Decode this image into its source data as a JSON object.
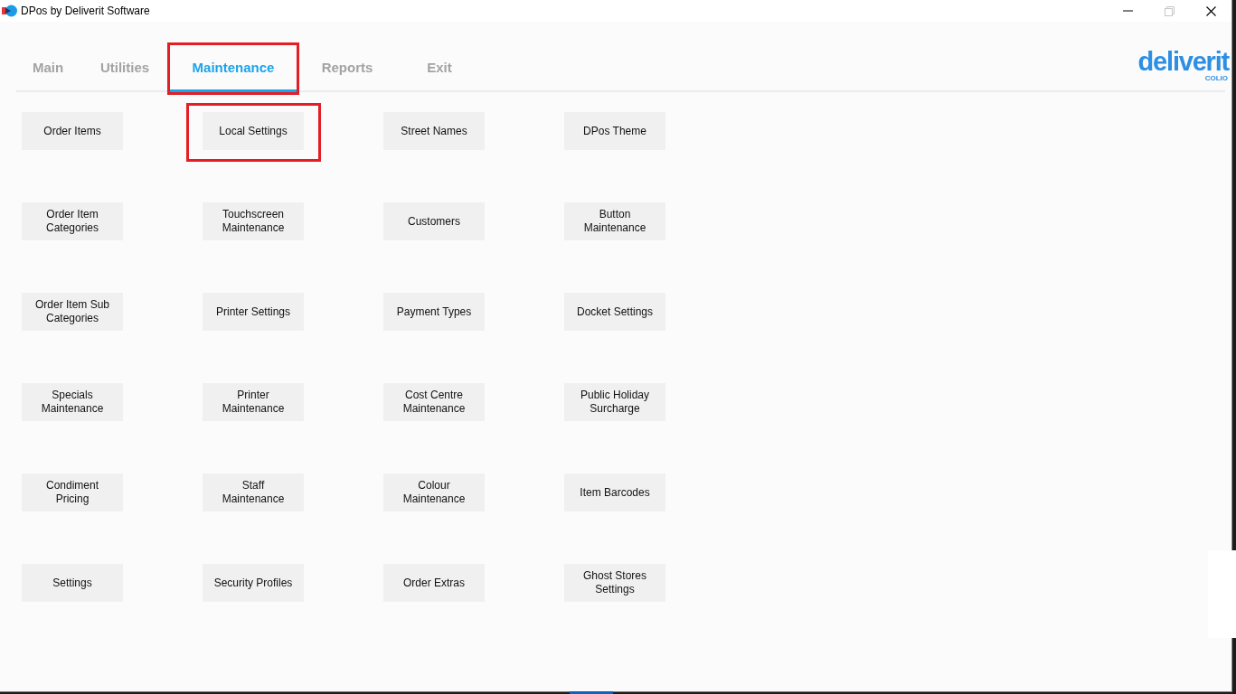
{
  "window": {
    "title": "DPos by Deliverit Software",
    "controls": [
      {
        "kind": "minimize",
        "disabled": false
      },
      {
        "kind": "restore",
        "disabled": true
      },
      {
        "kind": "close",
        "disabled": false
      }
    ]
  },
  "tabs": [
    {
      "label": "Main",
      "selected": false,
      "highlighted": false
    },
    {
      "label": "Utilities",
      "selected": false,
      "highlighted": false
    },
    {
      "label": "Maintenance",
      "selected": true,
      "highlighted": true
    },
    {
      "label": "Reports",
      "selected": false,
      "highlighted": false
    },
    {
      "label": "Exit",
      "selected": false,
      "highlighted": false
    }
  ],
  "logo": {
    "wordmark": "deliverit",
    "tagline": "COLIO"
  },
  "buttons": [
    {
      "label": "Order Items",
      "highlighted": false
    },
    {
      "label": "Local Settings",
      "highlighted": true
    },
    {
      "label": "Street Names",
      "highlighted": false
    },
    {
      "label": "DPos Theme",
      "highlighted": false
    },
    {
      "label": "Order Item Categories",
      "highlighted": false
    },
    {
      "label": "Touchscreen Maintenance",
      "highlighted": false
    },
    {
      "label": "Customers",
      "highlighted": false
    },
    {
      "label": "Button Maintenance",
      "highlighted": false
    },
    {
      "label": "Order Item Sub Categories",
      "highlighted": false
    },
    {
      "label": "Printer Settings",
      "highlighted": false
    },
    {
      "label": "Payment Types",
      "highlighted": false
    },
    {
      "label": "Docket Settings",
      "highlighted": false
    },
    {
      "label": "Specials Maintenance",
      "highlighted": false
    },
    {
      "label": "Printer Maintenance",
      "highlighted": false
    },
    {
      "label": "Cost Centre Maintenance",
      "highlighted": false
    },
    {
      "label": "Public Holiday Surcharge",
      "highlighted": false
    },
    {
      "label": "Condiment Pricing",
      "highlighted": false
    },
    {
      "label": "Staff Maintenance",
      "highlighted": false
    },
    {
      "label": "Colour Maintenance",
      "highlighted": false
    },
    {
      "label": "Item Barcodes",
      "highlighted": false
    },
    {
      "label": "Settings",
      "highlighted": false
    },
    {
      "label": "Security Profiles",
      "highlighted": false
    },
    {
      "label": "Order Extras",
      "highlighted": false
    },
    {
      "label": "Ghost Stores Settings",
      "highlighted": false
    }
  ]
}
